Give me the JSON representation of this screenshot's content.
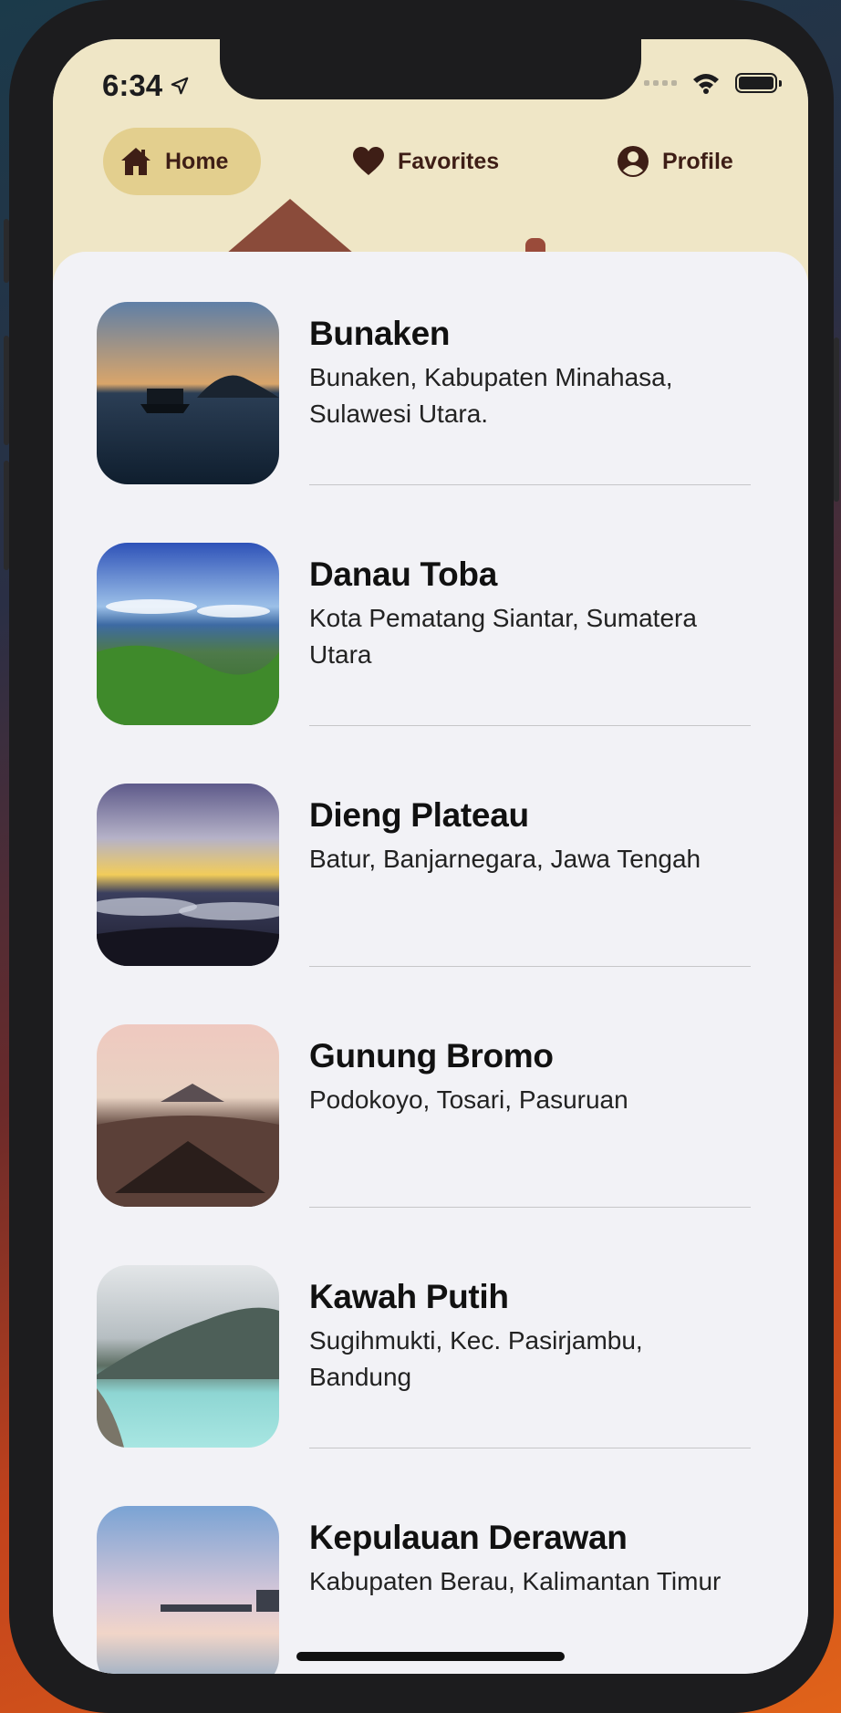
{
  "status_bar": {
    "time": "6:34"
  },
  "tabs": [
    {
      "label": "Home",
      "icon": "house-icon",
      "active": true
    },
    {
      "label": "Favorites",
      "icon": "heart-icon",
      "active": false
    },
    {
      "label": "Profile",
      "icon": "person-circle-icon",
      "active": false
    }
  ],
  "destinations": [
    {
      "name": "Bunaken",
      "location": "Bunaken, Kabupaten Minahasa, Sulawesi Utara."
    },
    {
      "name": "Danau Toba",
      "location": "Kota Pematang Siantar, Sumatera Utara"
    },
    {
      "name": "Dieng Plateau",
      "location": "Batur, Banjarnegara, Jawa Tengah"
    },
    {
      "name": "Gunung Bromo",
      "location": "Podokoyo, Tosari, Pasuruan"
    },
    {
      "name": "Kawah Putih",
      "location": "Sugihmukti, Kec. Pasirjambu, Bandung"
    },
    {
      "name": "Kepulauan Derawan",
      "location": "Kabupaten Berau, Kalimantan Timur"
    }
  ],
  "colors": {
    "header_bg": "#efe6c6",
    "active_tab_bg": "#e3cf8e",
    "tab_text": "#3e1e16",
    "list_bg": "#f2f2f6"
  }
}
